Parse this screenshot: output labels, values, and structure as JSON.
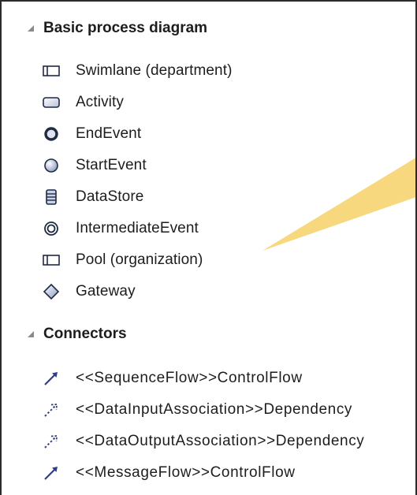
{
  "sections": [
    {
      "title": "Basic process diagram",
      "items": [
        {
          "label": "Swimlane (department)",
          "icon": "swimlane-icon"
        },
        {
          "label": "Activity",
          "icon": "activity-icon"
        },
        {
          "label": "EndEvent",
          "icon": "end-event-icon"
        },
        {
          "label": "StartEvent",
          "icon": "start-event-icon"
        },
        {
          "label": "DataStore",
          "icon": "datastore-icon"
        },
        {
          "label": "IntermediateEvent",
          "icon": "intermediate-event-icon"
        },
        {
          "label": "Pool (organization)",
          "icon": "pool-icon"
        },
        {
          "label": "Gateway",
          "icon": "gateway-icon"
        }
      ]
    },
    {
      "title": "Connectors",
      "items": [
        {
          "label": "<<SequenceFlow>>ControlFlow",
          "icon": "control-flow-arrow-icon"
        },
        {
          "label": "<<DataInputAssociation>>Dependency",
          "icon": "dependency-arrow-icon"
        },
        {
          "label": "<<DataOutputAssociation>>Dependency",
          "icon": "dependency-arrow-icon"
        },
        {
          "label": "<<MessageFlow>>ControlFlow",
          "icon": "control-flow-arrow-icon"
        }
      ]
    }
  ],
  "colors": {
    "text": "#1d1d1d",
    "callout": "#f7d87e",
    "icon_dark": "#1f2a44",
    "icon_blue": "#2a3f8f"
  }
}
